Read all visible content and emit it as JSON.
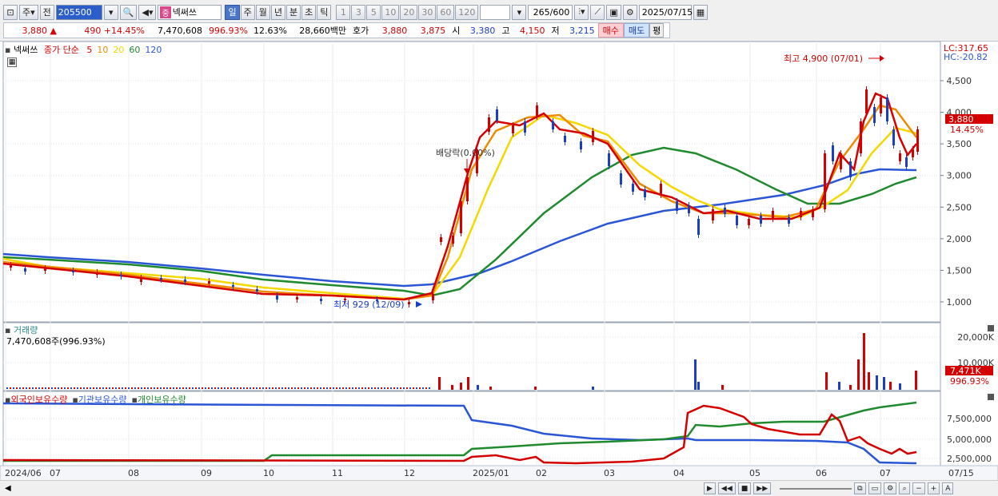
{
  "toolbar": {
    "market_label": "주",
    "prev_label": "전",
    "code_value": "205500",
    "stock_name": "넥써쓰",
    "stock_tag": "중",
    "period_buttons": [
      "일",
      "주",
      "월",
      "년",
      "분",
      "초",
      "틱"
    ],
    "active_period": "일",
    "interval_buttons": [
      "1",
      "3",
      "5",
      "10",
      "20",
      "30",
      "60",
      "120"
    ],
    "count_value": "265",
    "count_max": "/600",
    "date_value": "2025/07/15"
  },
  "quote": {
    "price": "3,880",
    "arrow": "▲",
    "change": "490",
    "change_pct": "+14.45%",
    "volume": "7,470,608",
    "volume_ratio": "996.93%",
    "turnover": "12.63%",
    "amount": "28,660백만",
    "hoga_label": "호가",
    "ask": "3,880",
    "bid": "3,875",
    "open_label": "시",
    "open": "3,380",
    "high_label": "고",
    "high": "4,150",
    "low_label": "저",
    "low": "3,215",
    "buy_label": "매수",
    "sell_label": "매도",
    "flat_label": "평"
  },
  "price_panel": {
    "legend_name": "넥써쓰",
    "legend_ma_prefix": "종가 단순",
    "ma_periods": [
      {
        "period": "5",
        "color": "#d40000"
      },
      {
        "period": "10",
        "color": "#f08a00"
      },
      {
        "period": "20",
        "color": "#f5d800"
      },
      {
        "period": "60",
        "color": "#1f8a2e"
      },
      {
        "period": "120",
        "color": "#2a56d6"
      }
    ],
    "lc_label": "LC:317.65",
    "hc_label": "HC:-20.82",
    "current_price_label": "3,880",
    "current_pct_label": "14.45%",
    "high_annotation": "최고 4,900 (07/01)",
    "low_annotation": "최저 929 (12/09)",
    "dividend_annotation": "배당락(0.00%)",
    "y_ticks": [
      "4,500",
      "4,000",
      "3,500",
      "3,000",
      "2,500",
      "2,000",
      "1,500",
      "1,000"
    ]
  },
  "volume_panel": {
    "title": "거래량",
    "value": "7,470,608주(996.93%)",
    "y_ticks": [
      "20,000K",
      "10,000K"
    ],
    "current_label": "7,471K",
    "current_pct": "996.93%"
  },
  "holding_panel": {
    "series": [
      {
        "name": "외국인보유수량",
        "color": "#d40000"
      },
      {
        "name": "기관보유수량",
        "color": "#2a56d6"
      },
      {
        "name": "개인보유수량",
        "color": "#1f8a2e"
      }
    ],
    "y_ticks": [
      "7,500,000",
      "5,000,000",
      "2,500,000"
    ]
  },
  "x_axis": {
    "labels": [
      "2024/06",
      "07",
      "08",
      "09",
      "10",
      "11",
      "12",
      "2025/01",
      "02",
      "03",
      "04",
      "05",
      "06",
      "07"
    ],
    "end_label": "07/15"
  },
  "colors": {
    "up": "#d40000",
    "down": "#1a3ec8",
    "ma5": "#d40000",
    "ma10": "#f08a00",
    "ma20": "#f5d800",
    "ma60": "#1f8a2e",
    "ma120": "#2a56d6"
  }
}
